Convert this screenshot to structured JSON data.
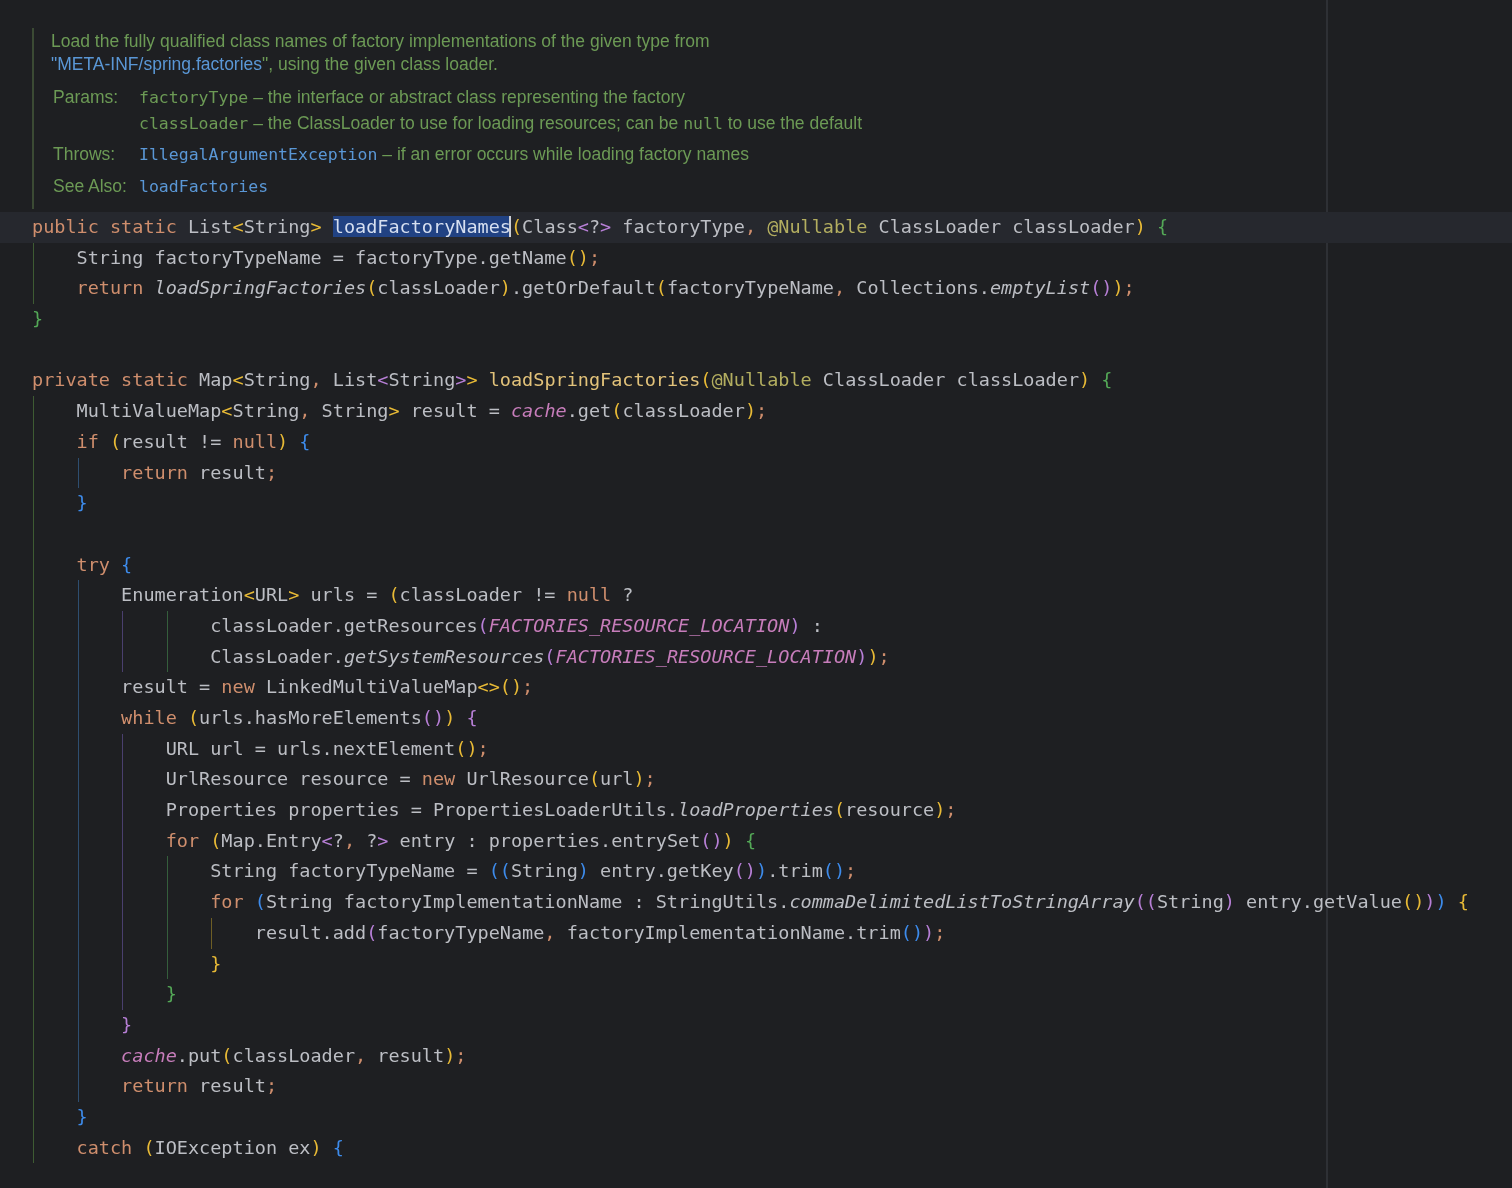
{
  "doc": {
    "summary": [
      {
        "text": "Load the fully qualified class names of factory implementations of the given type from ",
        "kind": "text"
      },
      {
        "text": "\"META-INF/spring.factories",
        "kind": "link"
      },
      {
        "text": "\", using the given class loader.",
        "kind": "text"
      }
    ],
    "sections": [
      {
        "label": "Params:",
        "items": [
          [
            {
              "text": "factoryType",
              "kind": "code"
            },
            {
              "text": " – the interface or abstract class representing the factory",
              "kind": "text"
            }
          ],
          [
            {
              "text": "classLoader",
              "kind": "code"
            },
            {
              "text": " – the ClassLoader to use for loading resources; can be ",
              "kind": "text"
            },
            {
              "text": "null",
              "kind": "code"
            },
            {
              "text": " to use the default",
              "kind": "text"
            }
          ]
        ]
      },
      {
        "label": "Throws:",
        "items": [
          [
            {
              "text": "IllegalArgumentException",
              "kind": "code-link"
            },
            {
              "text": " – if an error occurs while loading factory names",
              "kind": "text"
            }
          ]
        ]
      },
      {
        "label": "See Also:",
        "items": [
          [
            {
              "text": "loadFactories",
              "kind": "code-link"
            }
          ]
        ]
      }
    ]
  },
  "code": {
    "lines": [
      {
        "kind": "code",
        "current": true,
        "tokens": [
          {
            "text": "public static ",
            "kind": "kw"
          },
          {
            "text": "List",
            "kind": "plain"
          },
          {
            "text": "<",
            "kind": "br1"
          },
          {
            "text": "String",
            "kind": "plain"
          },
          {
            "text": "> ",
            "kind": "br1"
          },
          {
            "text": "loadFactoryNames",
            "kind": "decl",
            "selected": true
          },
          {
            "text": "(",
            "kind": "br1"
          },
          {
            "text": "Class",
            "kind": "plain"
          },
          {
            "text": "<",
            "kind": "br2"
          },
          {
            "text": "?",
            "kind": "plain"
          },
          {
            "text": ">",
            "kind": "br2"
          },
          {
            "text": " factoryType",
            "kind": "plain"
          },
          {
            "text": ", ",
            "kind": "punct"
          },
          {
            "text": "@Nullable",
            "kind": "annot"
          },
          {
            "text": " ClassLoader classLoader",
            "kind": "plain"
          },
          {
            "text": ")",
            "kind": "br1"
          },
          {
            "text": " {",
            "kind": "br4"
          }
        ]
      },
      {
        "kind": "code",
        "current": false,
        "tokens": [
          {
            "text": "    String factoryTypeName = factoryType.getName",
            "kind": "plain"
          },
          {
            "text": "()",
            "kind": "br1"
          },
          {
            "text": ";",
            "kind": "punct"
          }
        ]
      },
      {
        "kind": "code",
        "current": false,
        "tokens": [
          {
            "text": "    return ",
            "kind": "kw"
          },
          {
            "text": "loadSpringFactories",
            "kind": "call"
          },
          {
            "text": "(",
            "kind": "br1"
          },
          {
            "text": "classLoader",
            "kind": "plain"
          },
          {
            "text": ")",
            "kind": "br1"
          },
          {
            "text": ".getOrDefault",
            "kind": "plain"
          },
          {
            "text": "(",
            "kind": "br1"
          },
          {
            "text": "factoryTypeName",
            "kind": "plain"
          },
          {
            "text": ", ",
            "kind": "punct"
          },
          {
            "text": "Collections.",
            "kind": "plain"
          },
          {
            "text": "emptyList",
            "kind": "call"
          },
          {
            "text": "()",
            "kind": "br2"
          },
          {
            "text": ")",
            "kind": "br1"
          },
          {
            "text": ";",
            "kind": "punct"
          }
        ]
      },
      {
        "kind": "code",
        "current": false,
        "tokens": [
          {
            "text": "}",
            "kind": "br4"
          }
        ]
      },
      {
        "kind": "blank",
        "current": false
      },
      {
        "kind": "code",
        "current": false,
        "tokens": [
          {
            "text": "private static ",
            "kind": "kw"
          },
          {
            "text": "Map",
            "kind": "plain"
          },
          {
            "text": "<",
            "kind": "br1"
          },
          {
            "text": "String",
            "kind": "plain"
          },
          {
            "text": ", ",
            "kind": "punct"
          },
          {
            "text": "List",
            "kind": "plain"
          },
          {
            "text": "<",
            "kind": "br2"
          },
          {
            "text": "String",
            "kind": "plain"
          },
          {
            "text": ">",
            "kind": "br2"
          },
          {
            "text": "> ",
            "kind": "br1"
          },
          {
            "text": "loadSpringFactories",
            "kind": "decl"
          },
          {
            "text": "(",
            "kind": "br1"
          },
          {
            "text": "@Nullable",
            "kind": "annot"
          },
          {
            "text": " ClassLoader classLoader",
            "kind": "plain"
          },
          {
            "text": ")",
            "kind": "br1"
          },
          {
            "text": " {",
            "kind": "br4"
          }
        ]
      },
      {
        "kind": "code",
        "current": false,
        "tokens": [
          {
            "text": "    MultiValueMap",
            "kind": "plain"
          },
          {
            "text": "<",
            "kind": "br1"
          },
          {
            "text": "String",
            "kind": "plain"
          },
          {
            "text": ", ",
            "kind": "punct"
          },
          {
            "text": "String",
            "kind": "plain"
          },
          {
            "text": ">",
            "kind": "br1"
          },
          {
            "text": " result = ",
            "kind": "plain"
          },
          {
            "text": "cache",
            "kind": "field"
          },
          {
            "text": ".get",
            "kind": "plain"
          },
          {
            "text": "(",
            "kind": "br1"
          },
          {
            "text": "classLoader",
            "kind": "plain"
          },
          {
            "text": ")",
            "kind": "br1"
          },
          {
            "text": ";",
            "kind": "punct"
          }
        ]
      },
      {
        "kind": "code",
        "current": false,
        "tokens": [
          {
            "text": "    if ",
            "kind": "kw"
          },
          {
            "text": "(",
            "kind": "br1"
          },
          {
            "text": "result != ",
            "kind": "plain"
          },
          {
            "text": "null",
            "kind": "kw"
          },
          {
            "text": ")",
            "kind": "br1"
          },
          {
            "text": " {",
            "kind": "br3"
          }
        ]
      },
      {
        "kind": "code",
        "current": false,
        "tokens": [
          {
            "text": "        return ",
            "kind": "kw"
          },
          {
            "text": "result",
            "kind": "plain"
          },
          {
            "text": ";",
            "kind": "punct"
          }
        ]
      },
      {
        "kind": "code",
        "current": false,
        "tokens": [
          {
            "text": "    }",
            "kind": "br3"
          }
        ]
      },
      {
        "kind": "blank",
        "current": false
      },
      {
        "kind": "code",
        "current": false,
        "tokens": [
          {
            "text": "    try ",
            "kind": "kw"
          },
          {
            "text": "{",
            "kind": "br3"
          }
        ]
      },
      {
        "kind": "code",
        "current": false,
        "tokens": [
          {
            "text": "        Enumeration",
            "kind": "plain"
          },
          {
            "text": "<",
            "kind": "br1"
          },
          {
            "text": "URL",
            "kind": "plain"
          },
          {
            "text": ">",
            "kind": "br1"
          },
          {
            "text": " urls = ",
            "kind": "plain"
          },
          {
            "text": "(",
            "kind": "br1"
          },
          {
            "text": "classLoader != ",
            "kind": "plain"
          },
          {
            "text": "null",
            "kind": "kw"
          },
          {
            "text": " ?",
            "kind": "plain"
          }
        ]
      },
      {
        "kind": "code",
        "current": false,
        "tokens": [
          {
            "text": "                classLoader.getResources",
            "kind": "plain"
          },
          {
            "text": "(",
            "kind": "br2"
          },
          {
            "text": "FACTORIES_RESOURCE_LOCATION",
            "kind": "field"
          },
          {
            "text": ")",
            "kind": "br2"
          },
          {
            "text": " :",
            "kind": "plain"
          }
        ]
      },
      {
        "kind": "code",
        "current": false,
        "tokens": [
          {
            "text": "                ClassLoader.",
            "kind": "plain"
          },
          {
            "text": "getSystemResources",
            "kind": "call"
          },
          {
            "text": "(",
            "kind": "br2"
          },
          {
            "text": "FACTORIES_RESOURCE_LOCATION",
            "kind": "field"
          },
          {
            "text": ")",
            "kind": "br2"
          },
          {
            "text": ")",
            "kind": "br1"
          },
          {
            "text": ";",
            "kind": "punct"
          }
        ]
      },
      {
        "kind": "code",
        "current": false,
        "tokens": [
          {
            "text": "        result = ",
            "kind": "plain"
          },
          {
            "text": "new",
            "kind": "kw"
          },
          {
            "text": " LinkedMultiValueMap",
            "kind": "plain"
          },
          {
            "text": "<>()",
            "kind": "br1"
          },
          {
            "text": ";",
            "kind": "punct"
          }
        ]
      },
      {
        "kind": "code",
        "current": false,
        "tokens": [
          {
            "text": "        while ",
            "kind": "kw"
          },
          {
            "text": "(",
            "kind": "br1"
          },
          {
            "text": "urls.hasMoreElements",
            "kind": "plain"
          },
          {
            "text": "()",
            "kind": "br2"
          },
          {
            "text": ")",
            "kind": "br1"
          },
          {
            "text": " {",
            "kind": "br2"
          }
        ]
      },
      {
        "kind": "code",
        "current": false,
        "tokens": [
          {
            "text": "            URL url = urls.nextElement",
            "kind": "plain"
          },
          {
            "text": "()",
            "kind": "br1"
          },
          {
            "text": ";",
            "kind": "punct"
          }
        ]
      },
      {
        "kind": "code",
        "current": false,
        "tokens": [
          {
            "text": "            UrlResource resource = ",
            "kind": "plain"
          },
          {
            "text": "new",
            "kind": "kw"
          },
          {
            "text": " UrlResource",
            "kind": "plain"
          },
          {
            "text": "(",
            "kind": "br1"
          },
          {
            "text": "url",
            "kind": "plain"
          },
          {
            "text": ")",
            "kind": "br1"
          },
          {
            "text": ";",
            "kind": "punct"
          }
        ]
      },
      {
        "kind": "code",
        "current": false,
        "tokens": [
          {
            "text": "            Properties properties = PropertiesLoaderUtils.",
            "kind": "plain"
          },
          {
            "text": "loadProperties",
            "kind": "call"
          },
          {
            "text": "(",
            "kind": "br1"
          },
          {
            "text": "resource",
            "kind": "plain"
          },
          {
            "text": ")",
            "kind": "br1"
          },
          {
            "text": ";",
            "kind": "punct"
          }
        ]
      },
      {
        "kind": "code",
        "current": false,
        "tokens": [
          {
            "text": "            for ",
            "kind": "kw"
          },
          {
            "text": "(",
            "kind": "br1"
          },
          {
            "text": "Map.Entry",
            "kind": "plain"
          },
          {
            "text": "<",
            "kind": "br2"
          },
          {
            "text": "?",
            "kind": "plain"
          },
          {
            "text": ", ",
            "kind": "punct"
          },
          {
            "text": "?",
            "kind": "plain"
          },
          {
            "text": ">",
            "kind": "br2"
          },
          {
            "text": " entry : properties.entrySet",
            "kind": "plain"
          },
          {
            "text": "()",
            "kind": "br2"
          },
          {
            "text": ")",
            "kind": "br1"
          },
          {
            "text": " {",
            "kind": "br4"
          }
        ]
      },
      {
        "kind": "code",
        "current": false,
        "tokens": [
          {
            "text": "                String factoryTypeName = ",
            "kind": "plain"
          },
          {
            "text": "((",
            "kind": "br3"
          },
          {
            "text": "String",
            "kind": "plain"
          },
          {
            "text": ")",
            "kind": "br3"
          },
          {
            "text": " entry.getKey",
            "kind": "plain"
          },
          {
            "text": "()",
            "kind": "br2"
          },
          {
            "text": ")",
            "kind": "br3"
          },
          {
            "text": ".trim",
            "kind": "plain"
          },
          {
            "text": "()",
            "kind": "br3"
          },
          {
            "text": ";",
            "kind": "punct"
          }
        ]
      },
      {
        "kind": "code",
        "current": false,
        "tokens": [
          {
            "text": "                for ",
            "kind": "kw"
          },
          {
            "text": "(",
            "kind": "br3"
          },
          {
            "text": "String factoryImplementationName : StringUtils.",
            "kind": "plain"
          },
          {
            "text": "commaDelimitedListToStringArray",
            "kind": "call"
          },
          {
            "text": "((",
            "kind": "br2"
          },
          {
            "text": "String",
            "kind": "plain"
          },
          {
            "text": ")",
            "kind": "br2"
          },
          {
            "text": " entry.getValue",
            "kind": "plain"
          },
          {
            "text": "()",
            "kind": "br1"
          },
          {
            "text": ")",
            "kind": "br2"
          },
          {
            "text": ")",
            "kind": "br3"
          },
          {
            "text": " {",
            "kind": "br1"
          }
        ]
      },
      {
        "kind": "code",
        "current": false,
        "tokens": [
          {
            "text": "                    result.add",
            "kind": "plain"
          },
          {
            "text": "(",
            "kind": "br2"
          },
          {
            "text": "factoryTypeName",
            "kind": "plain"
          },
          {
            "text": ", ",
            "kind": "punct"
          },
          {
            "text": "factoryImplementationName.trim",
            "kind": "plain"
          },
          {
            "text": "()",
            "kind": "br3"
          },
          {
            "text": ")",
            "kind": "br2"
          },
          {
            "text": ";",
            "kind": "punct"
          }
        ]
      },
      {
        "kind": "code",
        "current": false,
        "tokens": [
          {
            "text": "                }",
            "kind": "br1"
          }
        ]
      },
      {
        "kind": "code",
        "current": false,
        "tokens": [
          {
            "text": "            }",
            "kind": "br4"
          }
        ]
      },
      {
        "kind": "code",
        "current": false,
        "tokens": [
          {
            "text": "        }",
            "kind": "br2"
          }
        ]
      },
      {
        "kind": "code",
        "current": false,
        "tokens": [
          {
            "text": "        cache",
            "kind": "field"
          },
          {
            "text": ".put",
            "kind": "plain"
          },
          {
            "text": "(",
            "kind": "br1"
          },
          {
            "text": "classLoader",
            "kind": "plain"
          },
          {
            "text": ", ",
            "kind": "punct"
          },
          {
            "text": "result",
            "kind": "plain"
          },
          {
            "text": ")",
            "kind": "br1"
          },
          {
            "text": ";",
            "kind": "punct"
          }
        ]
      },
      {
        "kind": "code",
        "current": false,
        "tokens": [
          {
            "text": "        return ",
            "kind": "kw"
          },
          {
            "text": "result",
            "kind": "plain"
          },
          {
            "text": ";",
            "kind": "punct"
          }
        ]
      },
      {
        "kind": "code",
        "current": false,
        "tokens": [
          {
            "text": "    }",
            "kind": "br3"
          }
        ]
      },
      {
        "kind": "code",
        "current": false,
        "tokens": [
          {
            "text": "    catch ",
            "kind": "kw"
          },
          {
            "text": "(",
            "kind": "br1"
          },
          {
            "text": "IOException ex",
            "kind": "plain"
          },
          {
            "text": ")",
            "kind": "br1"
          },
          {
            "text": " {",
            "kind": "br3"
          }
        ]
      }
    ]
  }
}
